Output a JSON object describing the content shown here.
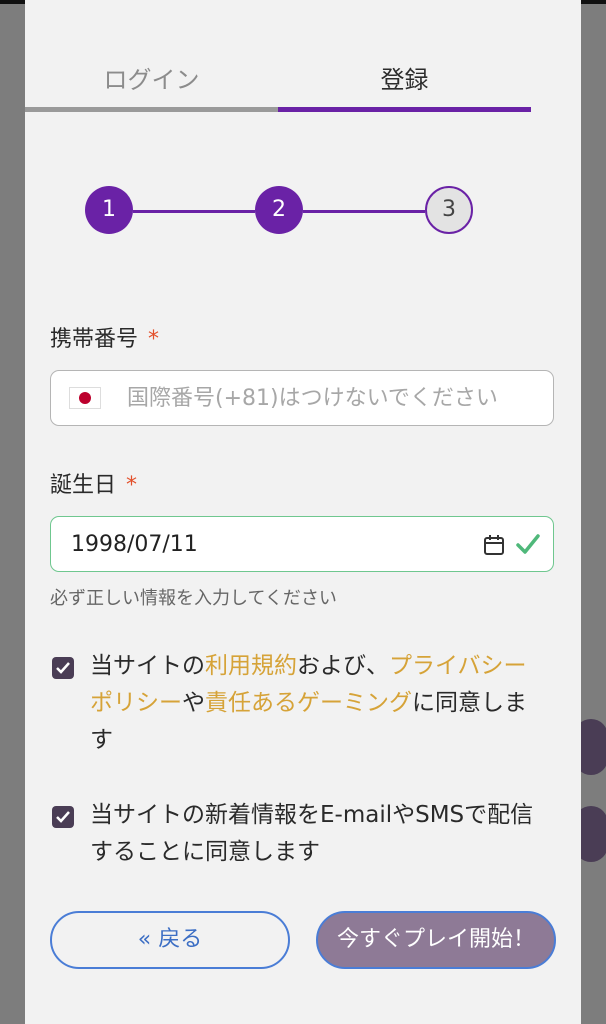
{
  "tabs": {
    "login": "ログイン",
    "register": "登録",
    "active": "register"
  },
  "stepper": {
    "steps": [
      "1",
      "2",
      "3"
    ],
    "current_step": 3
  },
  "phone": {
    "label": "携帯番号",
    "required_mark": "*",
    "placeholder": "国際番号(+81)はつけないでください",
    "value": ""
  },
  "birthday": {
    "label": "誕生日",
    "required_mark": "*",
    "value": "1998/07/11",
    "hint": "必ず正しい情報を入力してください"
  },
  "consents": [
    {
      "checked": true,
      "parts": [
        "当サイトの",
        "利用規約",
        "および、",
        "プライバシーポリシー",
        "や",
        "責任あるゲーミング",
        "に同意します"
      ]
    },
    {
      "checked": true,
      "text": "当サイトの新着情報をE-mailやSMSで配信することに同意します"
    }
  ],
  "buttons": {
    "back": "«  戻る",
    "start": "今すぐプレイ開始！"
  },
  "colors": {
    "accent": "#6a22a6",
    "link": "#d6a338",
    "error": "#e3502b",
    "valid": "#6fc78f",
    "button_border": "#4a7dd6"
  }
}
